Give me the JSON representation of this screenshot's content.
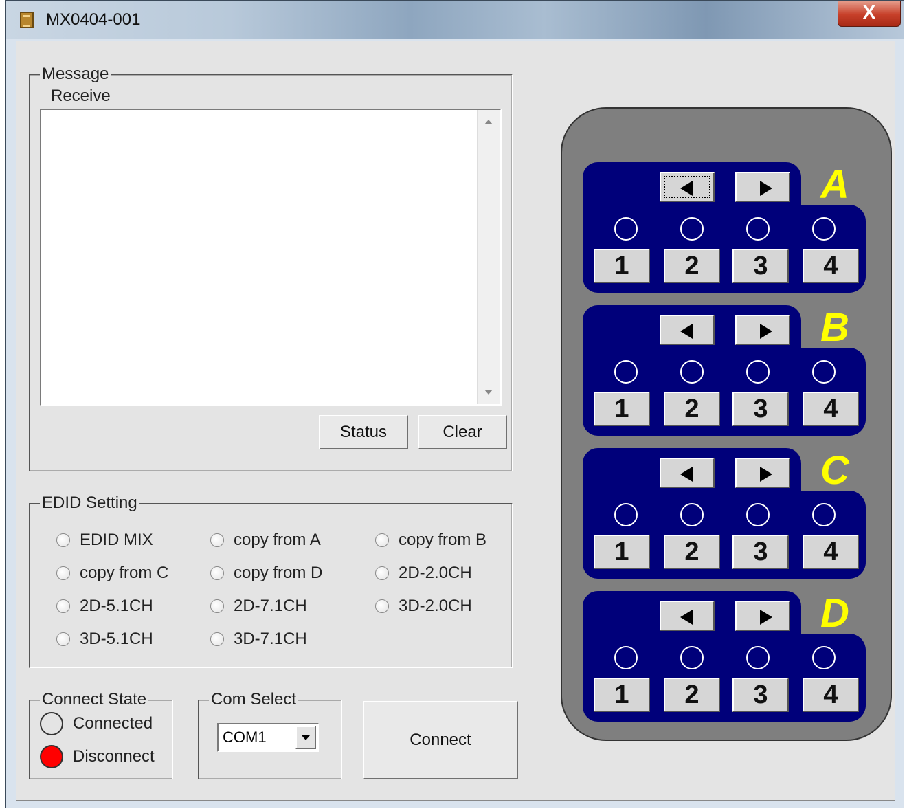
{
  "window": {
    "title": "MX0404-001",
    "close_label": "X"
  },
  "message": {
    "group_title": "Message",
    "receive_label": "Receive",
    "receive_text": "",
    "status_button": "Status",
    "clear_button": "Clear"
  },
  "edid": {
    "group_title": "EDID Setting",
    "options": [
      "EDID MIX",
      "copy from A",
      "copy from B",
      "copy from C",
      "copy from D",
      "2D-2.0CH",
      "2D-5.1CH",
      "2D-7.1CH",
      "3D-2.0CH",
      "3D-5.1CH",
      "3D-7.1CH"
    ]
  },
  "connect_state": {
    "group_title": "Connect State",
    "connected_label": "Connected",
    "disconnect_label": "Disconnect",
    "connected_color": "#e4e4e4",
    "disconnect_color": "#ff0000"
  },
  "com_select": {
    "group_title": "Com Select",
    "selected": "COM1"
  },
  "connect_button": "Connect",
  "matrix": {
    "panel_color": "#7f7f7f",
    "block_color": "#00007a",
    "letter_color": "#ffff00",
    "outputs": [
      {
        "letter": "A",
        "ports": [
          "1",
          "2",
          "3",
          "4"
        ]
      },
      {
        "letter": "B",
        "ports": [
          "1",
          "2",
          "3",
          "4"
        ]
      },
      {
        "letter": "C",
        "ports": [
          "1",
          "2",
          "3",
          "4"
        ]
      },
      {
        "letter": "D",
        "ports": [
          "1",
          "2",
          "3",
          "4"
        ]
      }
    ]
  }
}
